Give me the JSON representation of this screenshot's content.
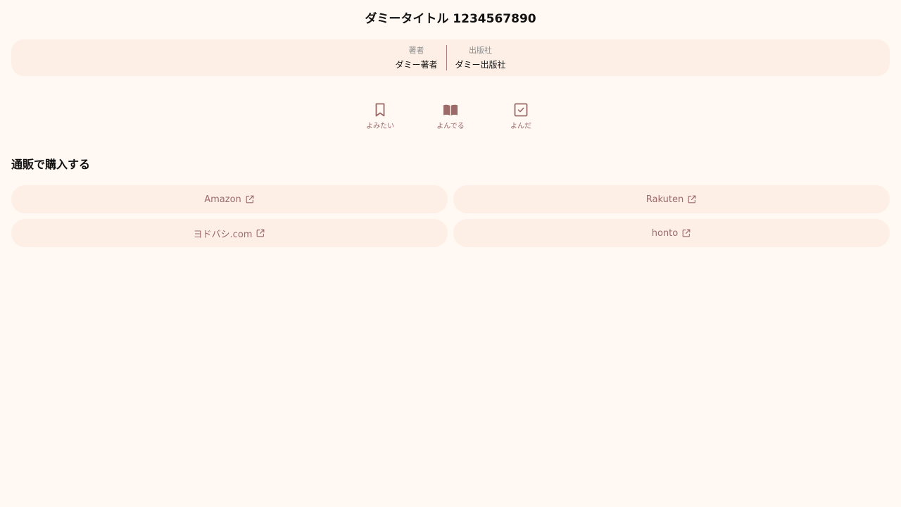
{
  "book": {
    "title": "ダミータイトル 1234567890",
    "author_label": "著者",
    "author": "ダミー著者",
    "publisher_label": "出版社",
    "publisher": "ダミー出版社"
  },
  "status": {
    "want_to_read": {
      "label": "よみたい",
      "icon": "bookmark-icon"
    },
    "reading": {
      "label": "よんでる",
      "icon": "open-book-icon"
    },
    "read": {
      "label": "よんだ",
      "icon": "checkbox-icon"
    }
  },
  "purchase": {
    "heading": "通販で購入する",
    "shops": [
      {
        "label": "Amazon",
        "icon": "external-link-icon"
      },
      {
        "label": "Rakuten",
        "icon": "external-link-icon"
      },
      {
        "label": "ヨドバシ.com",
        "icon": "external-link-icon"
      },
      {
        "label": "honto",
        "icon": "external-link-icon"
      }
    ]
  },
  "colors": {
    "background": "#fff8f3",
    "card": "#fdefe6",
    "accent": "#9c6a68"
  }
}
